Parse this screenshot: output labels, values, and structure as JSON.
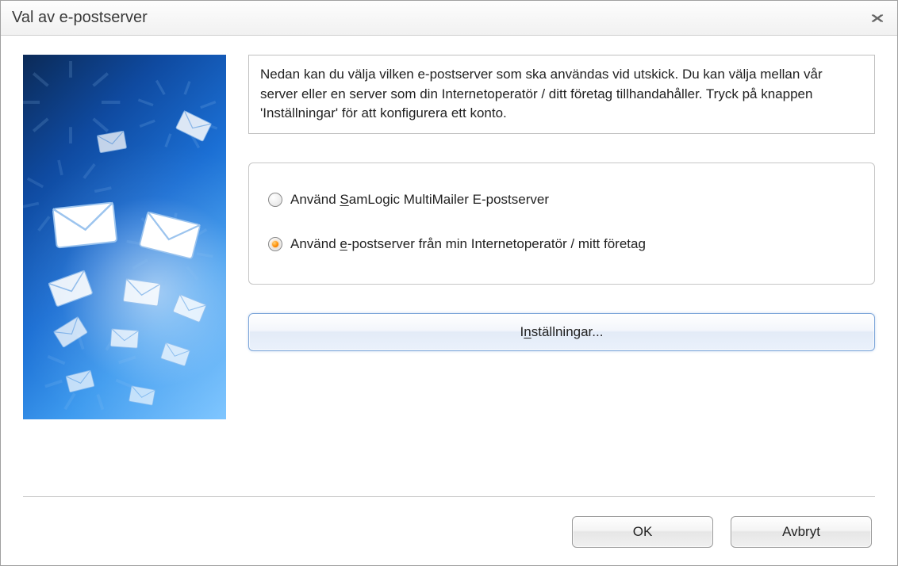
{
  "window": {
    "title": "Val av e-postserver"
  },
  "description": "Nedan kan du välja vilken e-postserver som ska användas vid utskick. Du kan välja mellan vår server eller en server som din Internetoperatör / ditt företag tillhandahåller. Tryck på knappen 'Inställningar' för att konfigurera ett konto.",
  "radios": {
    "option1": {
      "prefix": "Använd ",
      "mnemonic": "S",
      "suffix": "amLogic MultiMailer E-postserver",
      "checked": false
    },
    "option2": {
      "prefix": "Använd ",
      "mnemonic": "e",
      "suffix": "-postserver från min Internetoperatör / mitt företag",
      "checked": true
    }
  },
  "buttons": {
    "settings_prefix": "I",
    "settings_mnemonic": "n",
    "settings_suffix": "ställningar...",
    "ok": "OK",
    "cancel": "Avbryt"
  }
}
